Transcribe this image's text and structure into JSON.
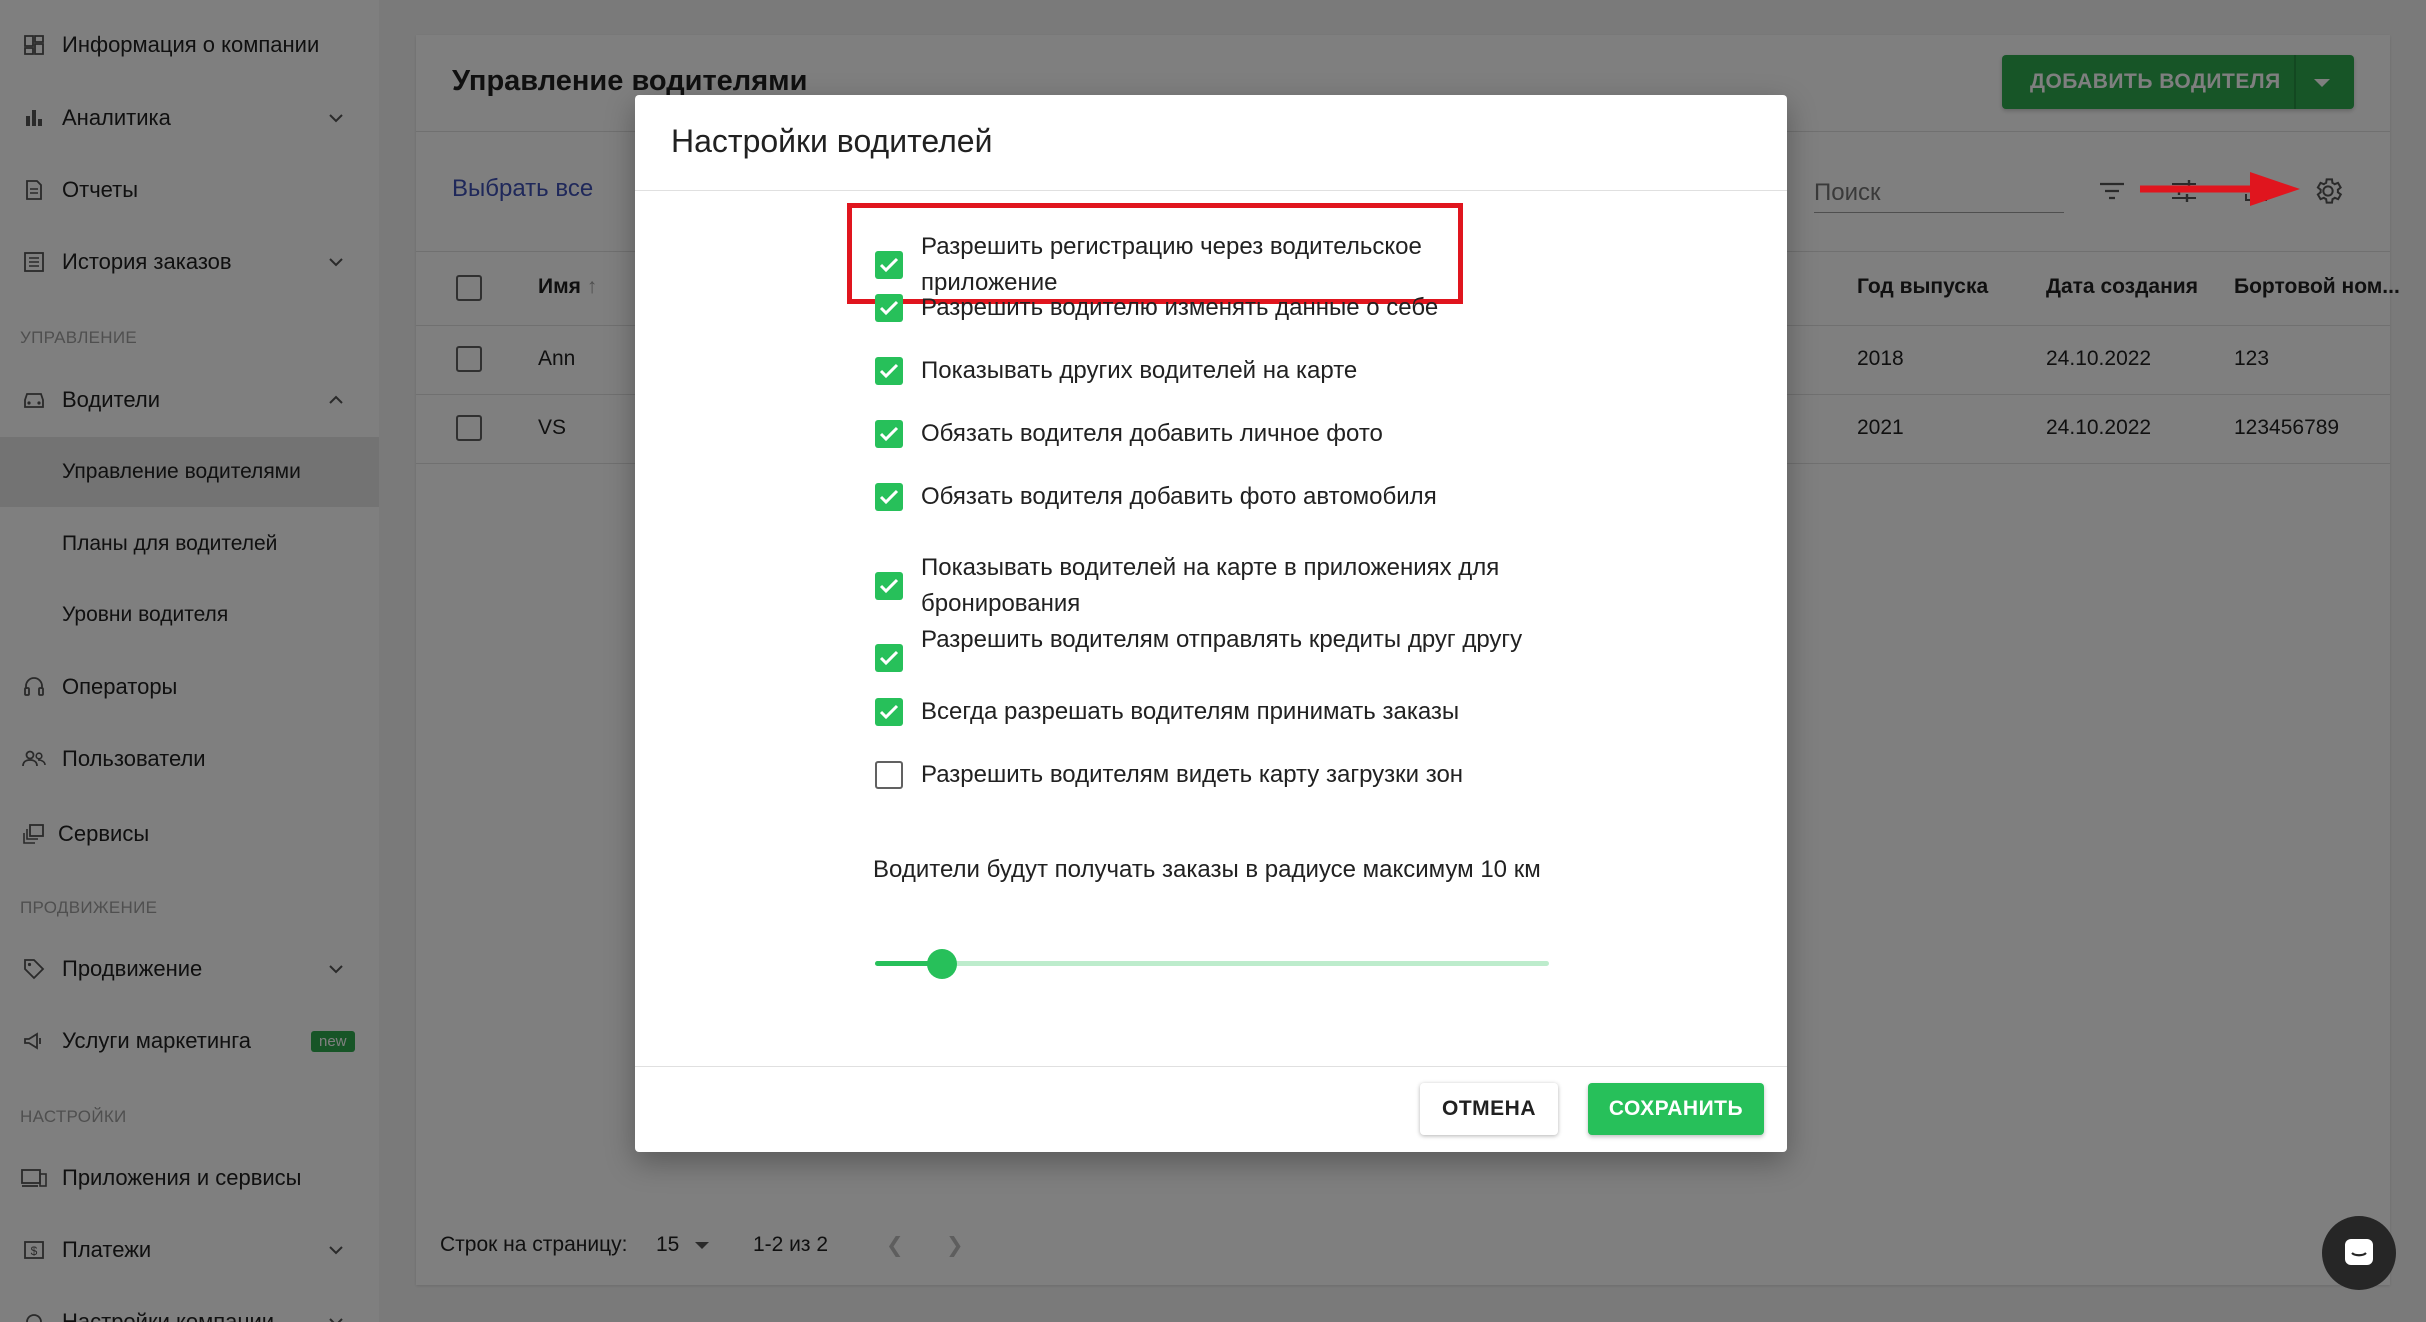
{
  "sidebar": {
    "items": [
      {
        "label": "Информация о компании"
      },
      {
        "label": "Аналитика"
      },
      {
        "label": "Отчеты"
      },
      {
        "label": "История заказов"
      }
    ],
    "section_management": "УПРАВЛЕНИЕ",
    "drivers": {
      "label": "Водители",
      "subitems": [
        {
          "label": "Управление водителями"
        },
        {
          "label": "Планы для водителей"
        },
        {
          "label": "Уровни водителя"
        }
      ]
    },
    "operators": "Операторы",
    "users": "Пользователи",
    "services": "Сервисы",
    "section_promotion": "ПРОДВИЖЕНИЕ",
    "promotion": "Продвижение",
    "marketing": "Услуги маркетинга",
    "new_badge": "new",
    "section_settings": "НАСТРОЙКИ",
    "apps": "Приложения и сервисы",
    "payments": "Платежи",
    "company_settings": "Настройки компании"
  },
  "main": {
    "title": "Управление водителями",
    "add_button": "ДОБАВИТЬ ВОДИТЕЛЯ",
    "select_all": "Выбрать все",
    "search_placeholder": "Поиск",
    "columns": {
      "name": "Имя",
      "year": "Год выпуска",
      "created": "Дата создания",
      "board_no": "Бортовой ном..."
    },
    "rows": [
      {
        "name": "Ann",
        "year": "2018",
        "created": "24.10.2022",
        "board_no": "123"
      },
      {
        "name": "VS",
        "year": "2021",
        "created": "24.10.2022",
        "board_no": "123456789"
      }
    ],
    "rows_per_page_label": "Строк на страницу:",
    "rows_per_page": "15",
    "range": "1-2 из 2"
  },
  "modal": {
    "title": "Настройки водителей",
    "options": [
      {
        "text": "Разрешить регистрацию через водительское приложение",
        "checked": true
      },
      {
        "text": "Разрешить водителю изменять данные о себе",
        "checked": true
      },
      {
        "text": "Показывать других водителей на карте",
        "checked": true
      },
      {
        "text": "Обязать водителя добавить личное фото",
        "checked": true
      },
      {
        "text": "Обязать водителя добавить фото автомобиля",
        "checked": true
      },
      {
        "text": "Показывать водителей на карте в приложениях для бронирования",
        "checked": true
      },
      {
        "text": "Разрешить водителям отправлять кредиты друг другу",
        "checked": true
      },
      {
        "text": "Всегда разрешать водителям принимать заказы",
        "checked": true
      },
      {
        "text": "Разрешить водителям видеть карту загрузки зон",
        "checked": false
      }
    ],
    "radius_text": "Водители будут получать заказы в радиусе максимум 10 км",
    "radius_value_fraction": 0.1,
    "cancel": "ОТМЕНА",
    "save": "СОХРАНИТЬ"
  },
  "colors": {
    "accent_green": "#27c05a",
    "highlight_red": "#e0151e",
    "link_blue": "#3f51b5"
  }
}
